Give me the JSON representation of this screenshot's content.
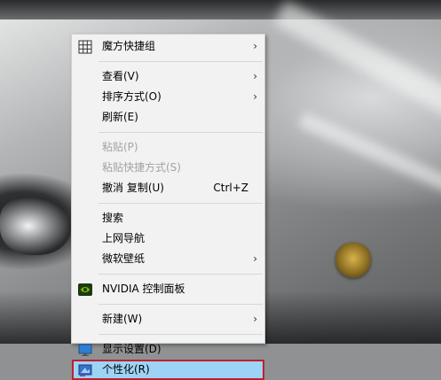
{
  "menu": {
    "items": [
      {
        "label": "魔方快捷组",
        "icon": "grid-icon",
        "submenu": true
      },
      {
        "label": "查看(V)",
        "submenu": true
      },
      {
        "label": "排序方式(O)",
        "submenu": true
      },
      {
        "label": "刷新(E)"
      },
      {
        "label": "粘贴(P)",
        "disabled": true
      },
      {
        "label": "粘贴快捷方式(S)",
        "disabled": true
      },
      {
        "label": "撤消 复制(U)",
        "shortcut": "Ctrl+Z"
      },
      {
        "label": "搜索"
      },
      {
        "label": "上网导航"
      },
      {
        "label": "微软壁纸",
        "submenu": true
      },
      {
        "label": "NVIDIA 控制面板",
        "icon": "nvidia-icon"
      },
      {
        "label": "新建(W)",
        "submenu": true
      },
      {
        "label": "显示设置(D)",
        "icon": "monitor-icon"
      },
      {
        "label": "个性化(R)",
        "icon": "personalize-icon",
        "selected": true
      }
    ],
    "arrow_glyph": "›",
    "selected_highlight": "#9dd3f5",
    "selected_border": "#c0202c"
  }
}
